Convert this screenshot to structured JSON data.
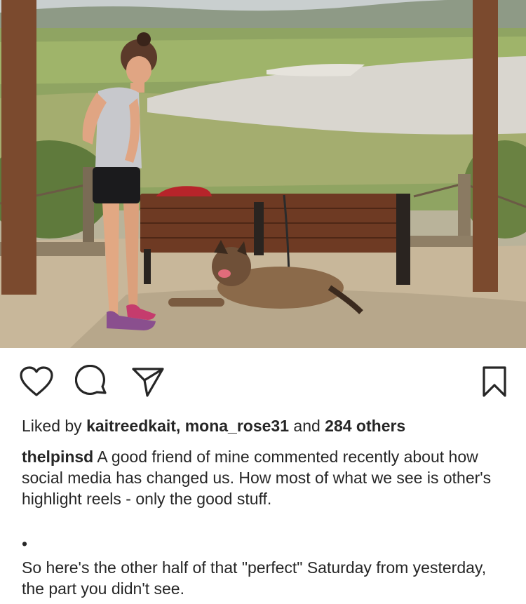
{
  "post": {
    "photo": {
      "alt_subject": "photo-woman-dog-bench"
    },
    "actions": {
      "like_icon": "heart-icon",
      "comment_icon": "comment-bubble-icon",
      "share_icon": "paper-plane-icon",
      "save_icon": "bookmark-icon"
    },
    "likes": {
      "prefix": "Liked by ",
      "user1": "kaitreedkait",
      "separator": ", ",
      "user2": "mona_rose31",
      "and_text": " and ",
      "others": "284 others"
    },
    "caption": {
      "username": "thelpinsd",
      "text": " A good friend of mine commented recently about how social media has changed us. How most of what we see is other's highlight reels - only the good stuff.",
      "bullet": "•",
      "text2": "So here's the other half of that \"perfect\" Saturday from yesterday, the part you didn't see."
    },
    "colors": {
      "text": "#262626",
      "background": "#ffffff",
      "icon_stroke": "#262626"
    }
  }
}
